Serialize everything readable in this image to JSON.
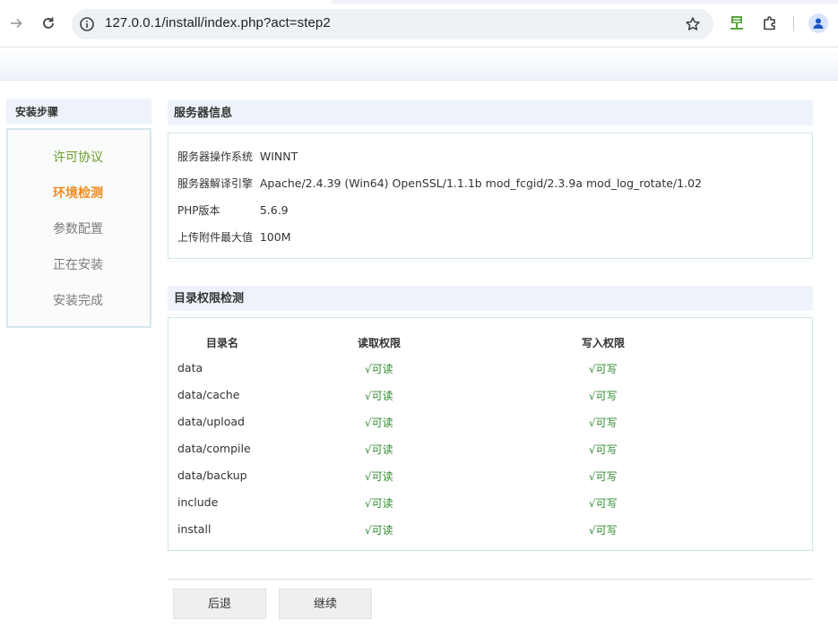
{
  "browser": {
    "url": "127.0.0.1/install/index.php?act=step2"
  },
  "sidebar": {
    "title": "安装步骤",
    "items": [
      {
        "label": "许可协议",
        "state": "done"
      },
      {
        "label": "环境检测",
        "state": "current"
      },
      {
        "label": "参数配置",
        "state": "pending"
      },
      {
        "label": "正在安装",
        "state": "pending"
      },
      {
        "label": "安装完成",
        "state": "pending"
      }
    ]
  },
  "server_info": {
    "title": "服务器信息",
    "rows": [
      {
        "label": "服务器操作系统",
        "value": "WINNT"
      },
      {
        "label": "服务器解译引擎",
        "value": "Apache/2.4.39 (Win64) OpenSSL/1.1.1b mod_fcgid/2.3.9a mod_log_rotate/1.02"
      },
      {
        "label": "PHP版本",
        "value": "5.6.9"
      },
      {
        "label": "上传附件最大值",
        "value": "100M"
      }
    ]
  },
  "dir_check": {
    "title": "目录权限检测",
    "headers": {
      "dir": "目录名",
      "read": "读取权限",
      "write": "写入权限"
    },
    "rows": [
      {
        "dir": "data",
        "read": "√可读",
        "write": "√可写"
      },
      {
        "dir": "data/cache",
        "read": "√可读",
        "write": "√可写"
      },
      {
        "dir": "data/upload",
        "read": "√可读",
        "write": "√可写"
      },
      {
        "dir": "data/compile",
        "read": "√可读",
        "write": "√可写"
      },
      {
        "dir": "data/backup",
        "read": "√可读",
        "write": "√可写"
      },
      {
        "dir": "include",
        "read": "√可读",
        "write": "√可写"
      },
      {
        "dir": "install",
        "read": "√可读",
        "write": "√可写"
      }
    ]
  },
  "actions": {
    "back": "后退",
    "continue": "继续"
  },
  "colors": {
    "done": "#6b9a2a",
    "current": "#f08a1c",
    "ok": "#2e8b2e",
    "panel_border": "#cfe6ea",
    "title_bg": "#eef3fb"
  }
}
